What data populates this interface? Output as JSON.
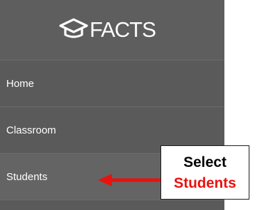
{
  "brand": {
    "name": "FACTS",
    "logo_icon": "graduation-cap-icon"
  },
  "nav": {
    "items": [
      {
        "label": "Home"
      },
      {
        "label": "Classroom"
      },
      {
        "label": "Students"
      }
    ]
  },
  "annotation": {
    "line1": "Select",
    "line2": "Students",
    "arrow_icon": "left-arrow-icon",
    "highlight_color": "#e8120e"
  },
  "colors": {
    "sidebar_bg": "#5a5a5a",
    "selected_bg": "#646464",
    "text": "#ffffff"
  }
}
